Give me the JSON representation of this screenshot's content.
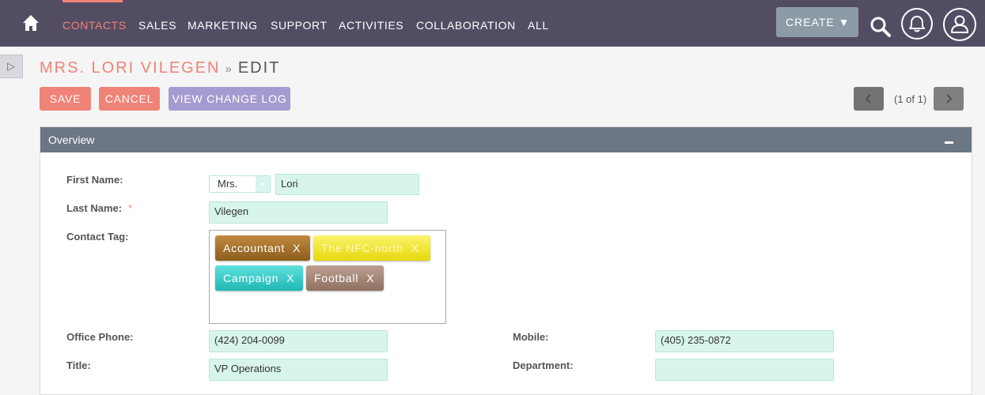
{
  "nav": {
    "home_icon": "home-icon",
    "items": [
      "CONTACTS",
      "SALES",
      "MARKETING",
      "SUPPORT",
      "ACTIVITIES",
      "COLLABORATION",
      "ALL"
    ],
    "active_item": "CONTACTS",
    "create_label": "CREATE ▼",
    "icons": [
      "search-icon",
      "bell-icon",
      "user-icon"
    ]
  },
  "header": {
    "record_name": "MRS. LORI VILEGEN",
    "separator": "»",
    "action": "EDIT"
  },
  "actions": {
    "save": "SAVE",
    "cancel": "CANCEL",
    "view_change_log": "VIEW CHANGE LOG"
  },
  "pager": {
    "text": "(1 of 1)"
  },
  "panel": {
    "title": "Overview"
  },
  "form": {
    "first_name_label": "First Name:",
    "salutation": "Mrs.",
    "first_name": "Lori",
    "last_name_label": "Last Name:",
    "required_mark": "*",
    "last_name": "Vilegen",
    "contact_tag_label": "Contact Tag:",
    "tags": [
      {
        "label": "Accountant",
        "remove": "X",
        "color": "#a6732c"
      },
      {
        "label": "The NFC-north",
        "remove": "X",
        "color": "#f1e51e"
      },
      {
        "label": "Campaign",
        "remove": "X",
        "color": "#2fc9c5"
      },
      {
        "label": "Football",
        "remove": "X",
        "color": "#a58775"
      }
    ],
    "office_phone_label": "Office Phone:",
    "office_phone": "(424) 204-0099",
    "mobile_label": "Mobile:",
    "mobile": "(405) 235-0872",
    "title_label": "Title:",
    "title": "VP Operations",
    "department_label": "Department:",
    "department": ""
  },
  "colors": {
    "nav_bg": "#534d64",
    "accent": "#f08377",
    "secondary_button": "#a59bd0",
    "panel_header": "#6b7783",
    "input_bg": "#d8f5ed"
  }
}
